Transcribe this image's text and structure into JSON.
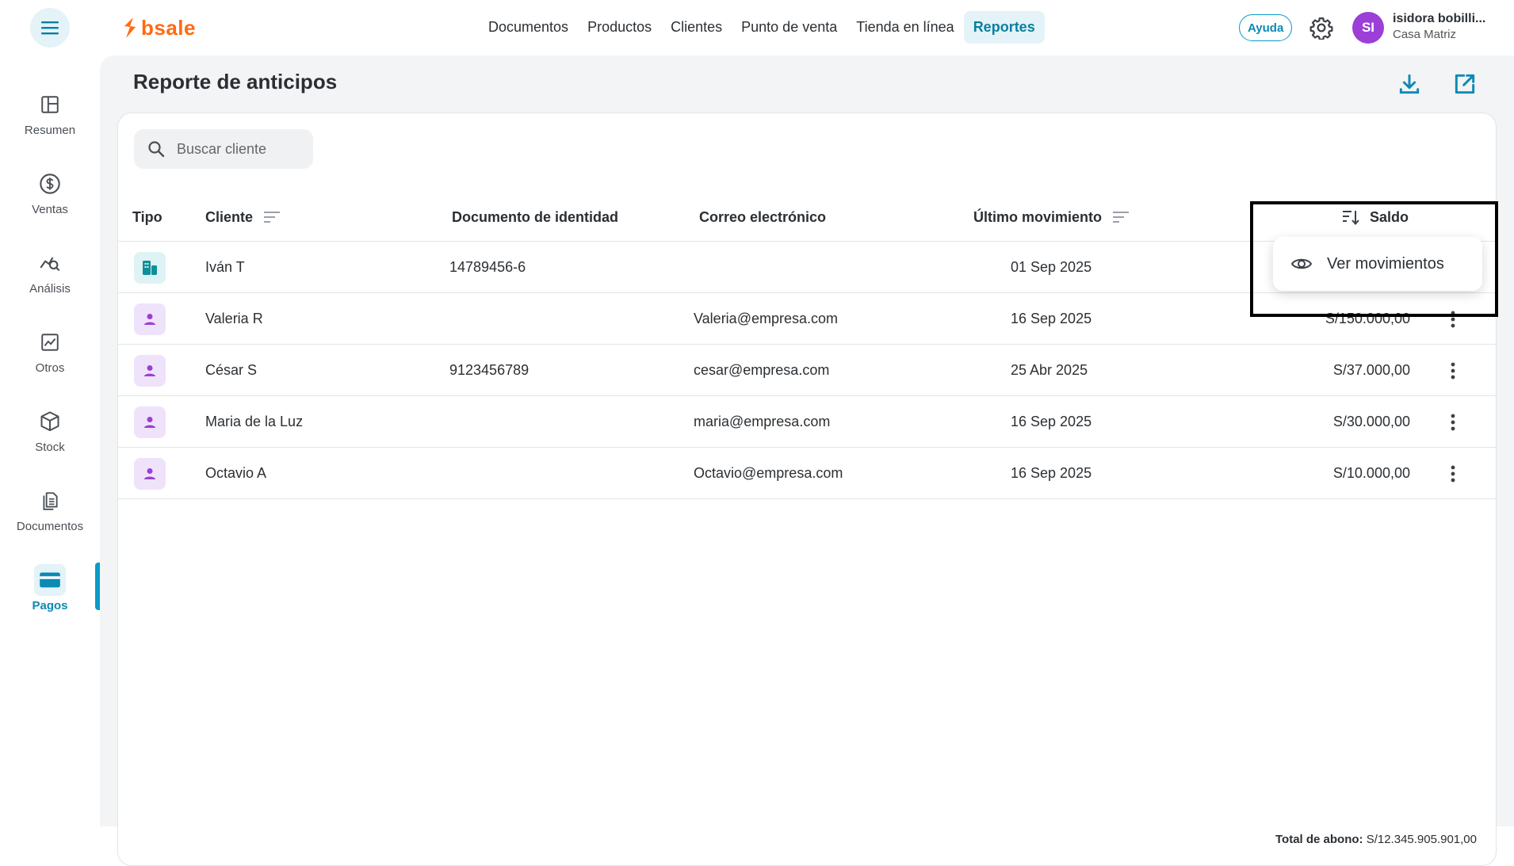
{
  "brand": {
    "logo_text": "bsale",
    "color": "#ff6a13"
  },
  "topnav": {
    "items": [
      "Documentos",
      "Productos",
      "Clientes",
      "Punto de venta",
      "Tienda en línea",
      "Reportes"
    ],
    "active": "Reportes"
  },
  "header": {
    "help_label": "Ayuda",
    "avatar_initials": "SI",
    "user_name": "isidora bobilli...",
    "user_branch": "Casa Matriz"
  },
  "sidebar": {
    "items": [
      {
        "label": "Resumen",
        "icon": "layout-icon"
      },
      {
        "label": "Ventas",
        "icon": "dollar-icon"
      },
      {
        "label": "Análisis",
        "icon": "analytics-icon"
      },
      {
        "label": "Otros",
        "icon": "chart-icon"
      },
      {
        "label": "Stock",
        "icon": "box-icon"
      },
      {
        "label": "Documentos",
        "icon": "documents-icon"
      },
      {
        "label": "Pagos",
        "icon": "card-icon"
      }
    ],
    "active": "Pagos"
  },
  "page": {
    "title": "Reporte de anticipos"
  },
  "search": {
    "placeholder": "Buscar cliente",
    "value": ""
  },
  "table": {
    "columns": {
      "tipo": "Tipo",
      "cliente": "Cliente",
      "documento": "Documento de identidad",
      "correo": "Correo electrónico",
      "ultimo": "Último movimiento",
      "saldo": "Saldo"
    },
    "rows": [
      {
        "type": "company",
        "cliente": "Iván T",
        "documento": "14789456-6",
        "correo": "",
        "ultimo": "01 Sep 2025",
        "saldo": ""
      },
      {
        "type": "person",
        "cliente": "Valeria R",
        "documento": "",
        "correo": "Valeria@empresa.com",
        "ultimo": "16 Sep 2025",
        "saldo": "S/150.000,00"
      },
      {
        "type": "person",
        "cliente": "César S",
        "documento": "9123456789",
        "correo": "cesar@empresa.com",
        "ultimo": "25 Abr 2025",
        "saldo": "S/37.000,00"
      },
      {
        "type": "person",
        "cliente": "Maria de la Luz",
        "documento": "",
        "correo": "maria@empresa.com",
        "ultimo": "16 Sep 2025",
        "saldo": "S/30.000,00"
      },
      {
        "type": "person",
        "cliente": "Octavio A",
        "documento": "",
        "correo": "Octavio@empresa.com",
        "ultimo": "16 Sep 2025",
        "saldo": "S/10.000,00"
      }
    ]
  },
  "dropdown": {
    "label": "Ver movimientos",
    "icon": "eye-icon"
  },
  "footer": {
    "total_label": "Total de abono:",
    "total_value": "S/12.345.905.901,00"
  },
  "colors": {
    "accent": "#0b9ac9",
    "person_badge": "#9b3fd6",
    "company_badge": "#0f8f9a"
  }
}
